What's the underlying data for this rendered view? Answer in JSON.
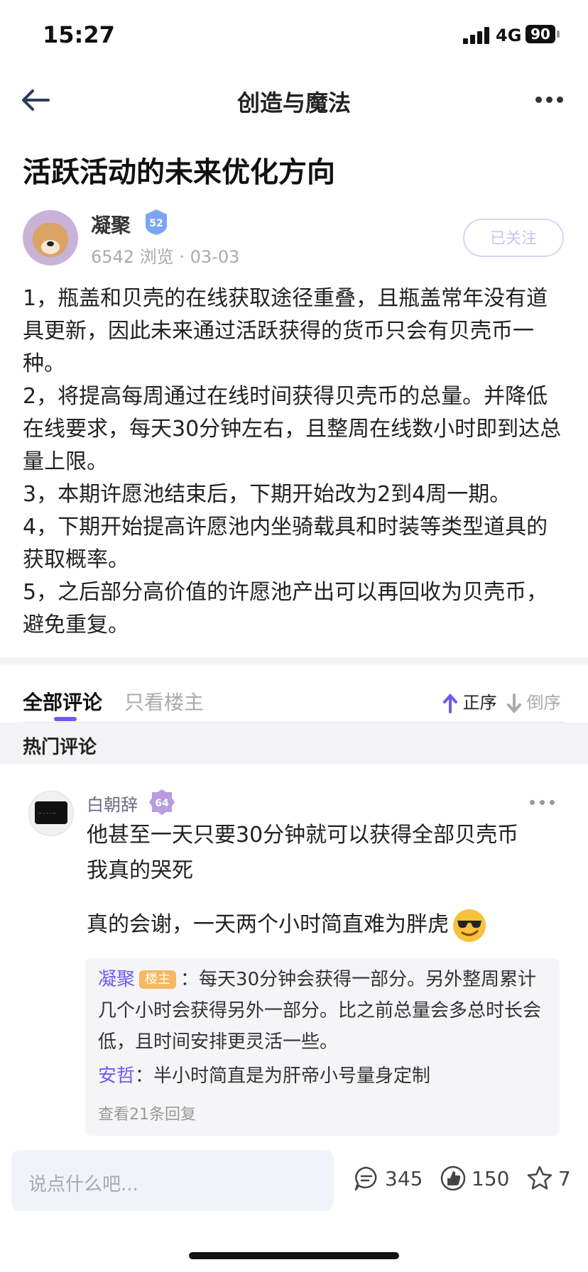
{
  "status_bar": {
    "time": "15:27",
    "network": "4G",
    "battery": "90"
  },
  "nav": {
    "title": "创造与魔法"
  },
  "post": {
    "title": "活跃活动的未来优化方向",
    "author": "凝聚",
    "author_level": "52",
    "views": "6542 浏览",
    "separator": "·",
    "date": "03-03",
    "follow_label": "已关注",
    "paragraphs": [
      "1，瓶盖和贝壳的在线获取途径重叠，且瓶盖常年没有道具更新，因此未来通过活跃获得的货币只会有贝壳币一种。",
      "2，将提高每周通过在线时间获得贝壳币的总量。并降低在线要求，每天30分钟左右，且整周在线数小时即到达总量上限。",
      "3，本期许愿池结束后，下期开始改为2到4周一期。",
      "4，下期开始提高许愿池内坐骑载具和时装等类型道具的获取概率。",
      "5，之后部分高价值的许愿池产出可以再回收为贝壳币，避免重复。"
    ]
  },
  "tabs": {
    "all": "全部评论",
    "op_only": "只看楼主",
    "sort_asc": "正序",
    "sort_desc": "倒序"
  },
  "hot_comments_label": "热门评论",
  "comment": {
    "author": "白朝辞",
    "level": "64",
    "lines": [
      "他甚至一天只要30分钟就可以获得全部贝壳币",
      "我真的哭死",
      "",
      "真的会谢，一天两个小时简直难为胖虎"
    ],
    "replies": [
      {
        "name": "凝聚",
        "tag": "楼主",
        "colon": "：",
        "text": "每天30分钟会获得一部分。另外整周累计几个小时会获得另外一部分。比之前总量会多总时长会低，且时间安排更灵活一些。"
      },
      {
        "name": "安哲",
        "colon": "：",
        "text": "半小时简直是为肝帝小号量身定制"
      }
    ],
    "view_more": "查看21条回复"
  },
  "bottom_bar": {
    "input_placeholder": "说点什么吧...",
    "comments_count": "345",
    "likes_count": "150",
    "favorites_count": "7"
  },
  "colors": {
    "accent": "#6b5cf0",
    "owner_tag": "#f5b860",
    "badge_blue": "#7aa6f0",
    "badge_purple": "#b89be0"
  }
}
